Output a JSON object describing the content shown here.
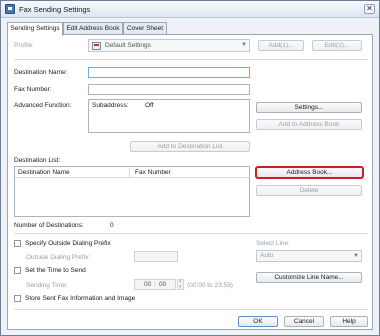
{
  "window": {
    "title": "Fax Sending Settings",
    "close_glyph": "✕"
  },
  "tabs": [
    {
      "label": "Sending Settings"
    },
    {
      "label": "Edit Address Book"
    },
    {
      "label": "Cover Sheet"
    }
  ],
  "profile": {
    "label": "Profile:",
    "value": "Default Settings",
    "icon": "fax-machine-icon",
    "add_button": "Add(1)...",
    "edit_button": "Edit(2)..."
  },
  "destination_name": {
    "label": "Destination Name:",
    "value": ""
  },
  "fax_number": {
    "label": "Fax Number:",
    "value": ""
  },
  "advanced_function": {
    "label": "Advanced Function:",
    "subaddress_label": "Subaddress:",
    "subaddress_value": "Off",
    "settings_button": "Settings...",
    "add_to_address_book_button": "Add to Address Book"
  },
  "add_to_destination_list_button": "Add to Destination List",
  "destination_list": {
    "label": "Destination List:",
    "columns": [
      "Destination Name",
      "Fax Number"
    ],
    "rows": [],
    "address_book_button": "Address Book...",
    "delete_button": "Delete"
  },
  "number_of_destinations": {
    "label": "Number of Destinations:",
    "value": "0"
  },
  "outside_dialing": {
    "checkbox_label": "Specify Outside Dialing Prefix",
    "prefix_label": "Outside Dialing Prefix:",
    "prefix_value": ""
  },
  "send_time": {
    "checkbox_label": "Set the Time to Send",
    "time_label": "Sending Time:",
    "hours": "00",
    "minutes": "00",
    "separator": ":",
    "range_hint": "(00:00 to 23:59)"
  },
  "store_info_checkbox_label": "Store Sent Fax Information and Image",
  "select_line": {
    "label": "Select Line:",
    "value": "Auto",
    "customize_button": "Customize Line Name..."
  },
  "footer": {
    "ok": "OK",
    "cancel": "Cancel",
    "help": "Help"
  },
  "colors": {
    "accent": "#cc1f1f",
    "tab_border": "#9aa7b8",
    "window_bg": "#eef1f6"
  }
}
